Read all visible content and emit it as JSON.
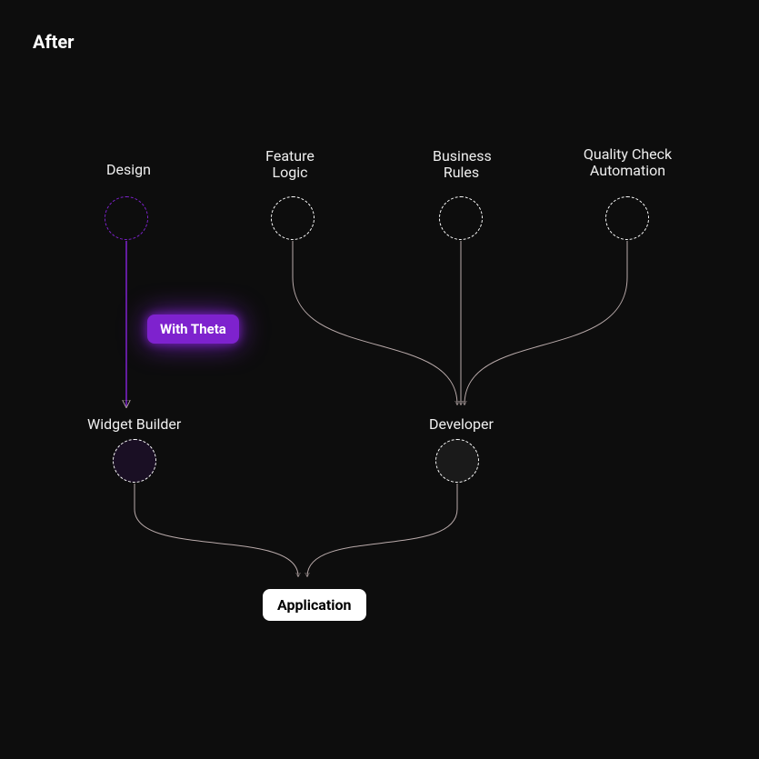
{
  "title": "After",
  "nodes": {
    "design": {
      "label": "Design"
    },
    "feature_logic": {
      "label": "Feature\nLogic"
    },
    "business_rules": {
      "label": "Business\nRules"
    },
    "quality_check": {
      "label": "Quality Check\nAutomation"
    },
    "widget_builder": {
      "label": "Widget Builder"
    },
    "developer": {
      "label": "Developer"
    },
    "application": {
      "label": "Application"
    }
  },
  "badge": {
    "label": "With Theta"
  },
  "colors": {
    "accent": "#7e22ce"
  }
}
